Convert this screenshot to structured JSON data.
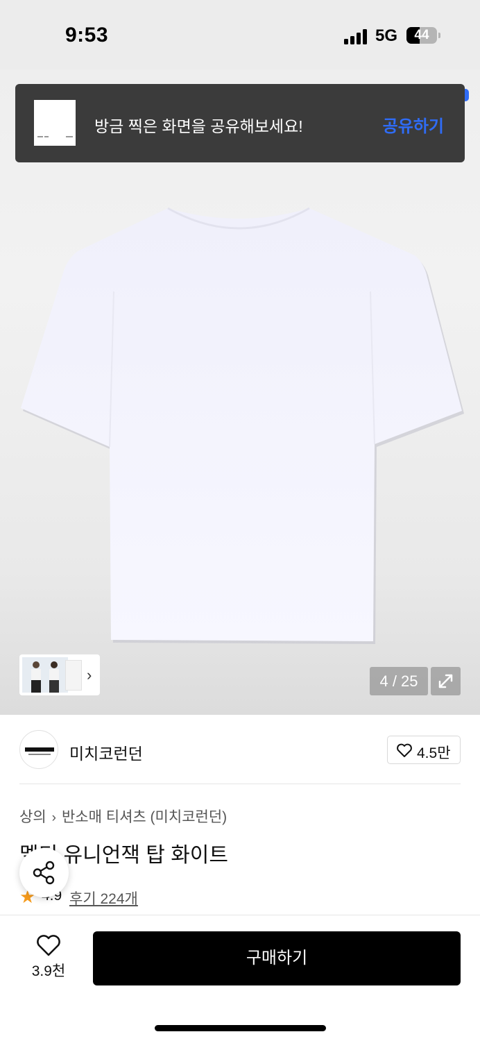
{
  "status_bar": {
    "time": "9:53",
    "network": "5G",
    "battery": "44"
  },
  "toast": {
    "message": "방금 찍은 화면을 공유해보세요!",
    "action_label": "공유하기"
  },
  "gallery": {
    "counter": "4 / 25",
    "thumb_chevron": "›"
  },
  "brand": {
    "name": "미치코런던",
    "likes": "4.5만"
  },
  "breadcrumb": {
    "category": "상의",
    "separator": "›",
    "subcategory": "반소매 티셔츠 (미치코런던)"
  },
  "product": {
    "title": "멜티 유니언잭 탑 화이트",
    "rating": "4.9",
    "reviews": "후기 224개"
  },
  "bottom_bar": {
    "wish_count": "3.9천",
    "buy_label": "구매하기"
  },
  "colors": {
    "accent": "#2f6cf6",
    "star": "#f59a1b",
    "buy_button": "#000000",
    "toast_bg": "#3b3b3b"
  },
  "icons": [
    "signal-icon",
    "battery-icon",
    "chevron-right-icon",
    "expand-icon",
    "heart-icon",
    "share-icon",
    "star-icon"
  ]
}
